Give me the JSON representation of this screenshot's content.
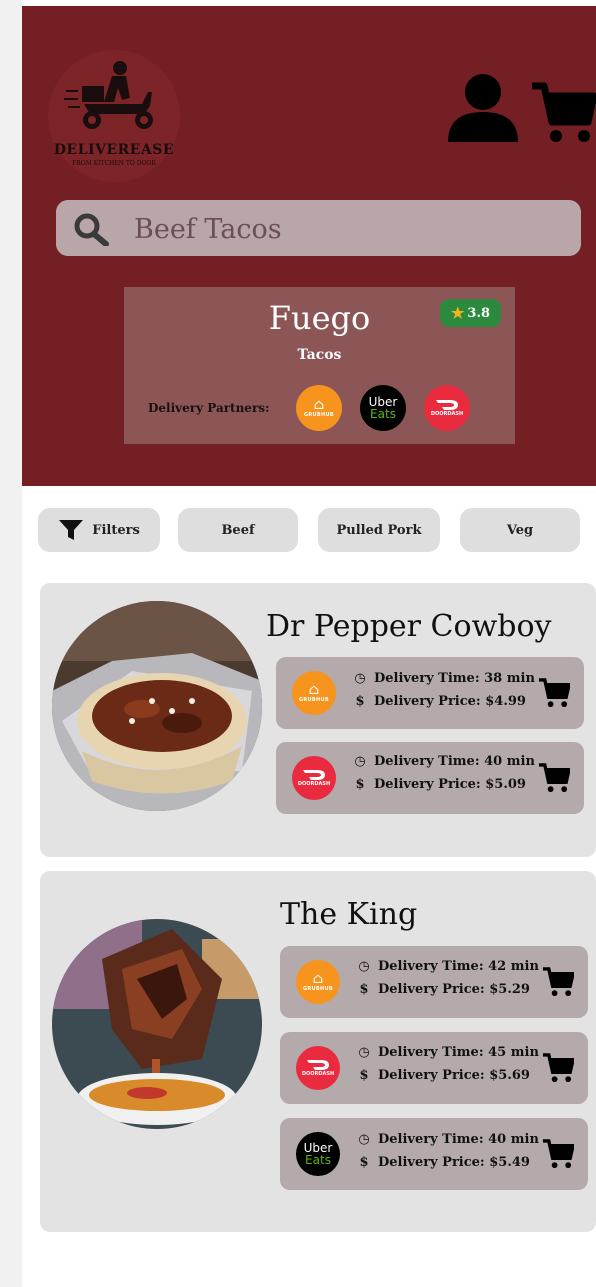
{
  "brand": {
    "name": "DELIVEREASE",
    "tagline": "FROM KITCHEN TO DOOR"
  },
  "search": {
    "placeholder": "Beef Tacos"
  },
  "restaurant": {
    "name": "Fuego",
    "category": "Tacos",
    "rating": "3.8",
    "partners_label": "Delivery Partners:",
    "partners": [
      "Grubhub",
      "Uber Eats",
      "DoorDash"
    ]
  },
  "partner_logos": {
    "grubhub": "GRUBHUB",
    "doordash": "DOORDASH",
    "ubereats_l1": "Uber",
    "ubereats_l2": "Eats"
  },
  "filters": {
    "filters_label": "Filters",
    "chips": [
      "Beef",
      "Pulled Pork",
      "Veg"
    ]
  },
  "items": [
    {
      "name": "Dr Pepper Cowboy",
      "offers": [
        {
          "partner": "grubhub",
          "time": "Delivery Time: 38 min",
          "price": "Delivery Price: $4.99"
        },
        {
          "partner": "doordash",
          "time": "Delivery Time: 40 min",
          "price": "Delivery Price: $5.09"
        }
      ]
    },
    {
      "name": "The King",
      "offers": [
        {
          "partner": "grubhub",
          "time": "Delivery Time: 42 min",
          "price": "Delivery Price: $5.29"
        },
        {
          "partner": "doordash",
          "time": "Delivery Time: 45 min",
          "price": "Delivery Price: $5.69"
        },
        {
          "partner": "ubereats",
          "time": "Delivery Time: 40 min",
          "price": "Delivery Price: $5.49"
        }
      ]
    }
  ],
  "colors": {
    "header": "#731f23",
    "card": "#e3e3e3",
    "offer": "#b4aaab",
    "rating": "#2c8a3e"
  }
}
